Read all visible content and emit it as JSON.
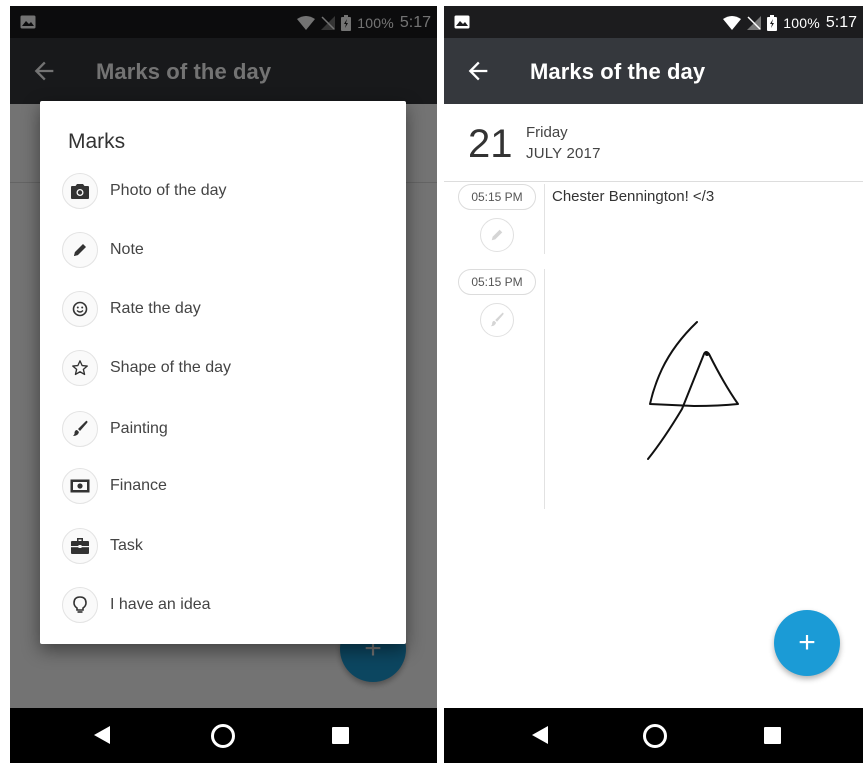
{
  "status_bar": {
    "battery": "100%",
    "time": "5:17"
  },
  "left": {
    "app_title": "Marks of the day",
    "dialog": {
      "title": "Marks",
      "items": [
        {
          "label": "Photo of the day",
          "icon": "camera-icon"
        },
        {
          "label": "Note",
          "icon": "pencil-icon"
        },
        {
          "label": "Rate the day",
          "icon": "smiley-icon"
        },
        {
          "label": "Shape of the day",
          "icon": "star-icon"
        },
        {
          "label": "Painting",
          "icon": "brush-icon"
        },
        {
          "label": "Finance",
          "icon": "money-icon"
        },
        {
          "label": "Task",
          "icon": "briefcase-icon"
        },
        {
          "label": "I have an idea",
          "icon": "lightbulb-icon"
        }
      ]
    }
  },
  "right": {
    "app_title": "Marks of the day",
    "date": {
      "day": "21",
      "weekday": "Friday",
      "month_year": "JULY 2017"
    },
    "entries": [
      {
        "time": "05:15 PM",
        "text": "Chester Bennington! </3",
        "icon": "pencil-icon"
      },
      {
        "time": "05:15 PM",
        "text": "",
        "icon": "brush-icon"
      }
    ]
  },
  "colors": {
    "appbar": "#35383d",
    "fab": "#1b9bd6",
    "statusbar": "#1c1c1e"
  }
}
